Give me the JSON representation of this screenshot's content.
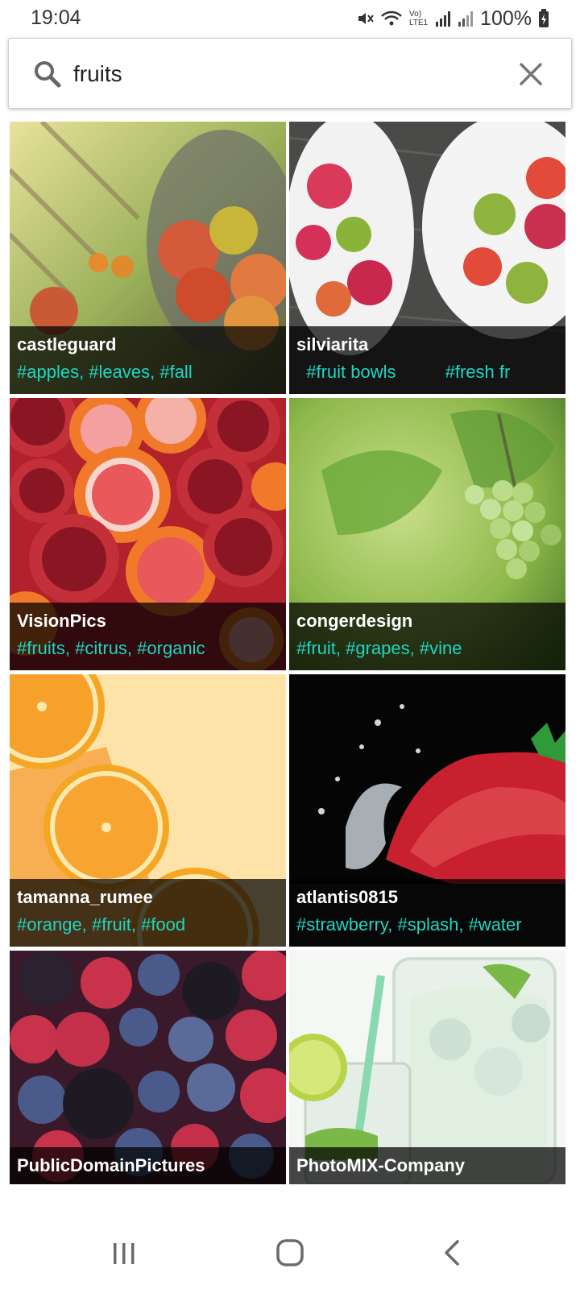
{
  "status_bar": {
    "time": "19:04",
    "network_label": "Vo) LTE1",
    "battery": "100%"
  },
  "search": {
    "value": "fruits",
    "icon": "search-icon",
    "clear_icon": "close-icon"
  },
  "results": [
    {
      "author": "castleguard",
      "tags": "#apples, #leaves, #fall"
    },
    {
      "author": "silviarita",
      "tags": "  #fruit bowls          #fresh fr"
    },
    {
      "author": "VisionPics",
      "tags": "#fruits, #citrus, #organic"
    },
    {
      "author": "congerdesign",
      "tags": "#fruit, #grapes, #vine"
    },
    {
      "author": "tamanna_rumee",
      "tags": "#orange, #fruit, #food"
    },
    {
      "author": "atlantis0815",
      "tags": "#strawberry, #splash, #water"
    },
    {
      "author": "PublicDomainPictures",
      "tags": ""
    },
    {
      "author": "PhotoMIX-Company",
      "tags": ""
    }
  ],
  "nav": {
    "recents_icon": "recents-icon",
    "home_icon": "home-icon",
    "back_icon": "back-icon"
  },
  "colors": {
    "tag_color": "#1fd6c3",
    "caption_bg": "rgba(0,0,0,0.72)"
  }
}
